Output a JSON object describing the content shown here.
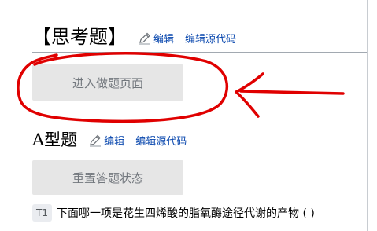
{
  "think_section": {
    "title": "【思考题】",
    "edit_label": "编辑",
    "edit_source_label": "编辑源代码",
    "enter_button": "进入做题页面"
  },
  "a_section": {
    "title": "A型题",
    "edit_label": "编辑",
    "edit_source_label": "编辑源代码",
    "reset_button": "重置答题状态"
  },
  "question": {
    "number": "T1",
    "text": "下面哪一项是花生四烯酸的脂氧酶途径代谢的产物 ( )"
  },
  "colors": {
    "link": "#0645ad",
    "annotation": "#e00000",
    "button_bg": "#e6e6e6"
  },
  "icons": {
    "edit": "pencil-icon"
  }
}
